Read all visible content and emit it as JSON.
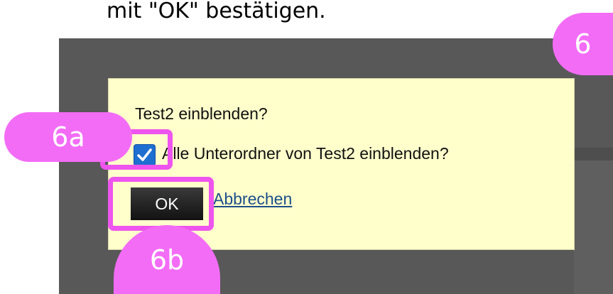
{
  "instruction": {
    "text": "mit \"OK\" bestätigen."
  },
  "dialog": {
    "question": "Test2 einblenden?",
    "checkbox_label": "Alle Unterordner von Test2 einblenden?",
    "checkbox_checked": true,
    "ok_label": "OK",
    "cancel_label": "Abbrechen"
  },
  "annotations": {
    "step_main": "6",
    "step_checkbox": "6a",
    "step_ok": "6b",
    "highlight_color": "#ee55ee",
    "bubble_color": "#f36cf6"
  },
  "colors": {
    "dialog_background": "#ffffcc",
    "overlay": "#585858",
    "checkbox_accent": "#1e6fd0",
    "ok_button": "#1a1a1a",
    "link": "#1b4f8a"
  },
  "icons": {
    "checkbox": "checkmark-icon"
  }
}
